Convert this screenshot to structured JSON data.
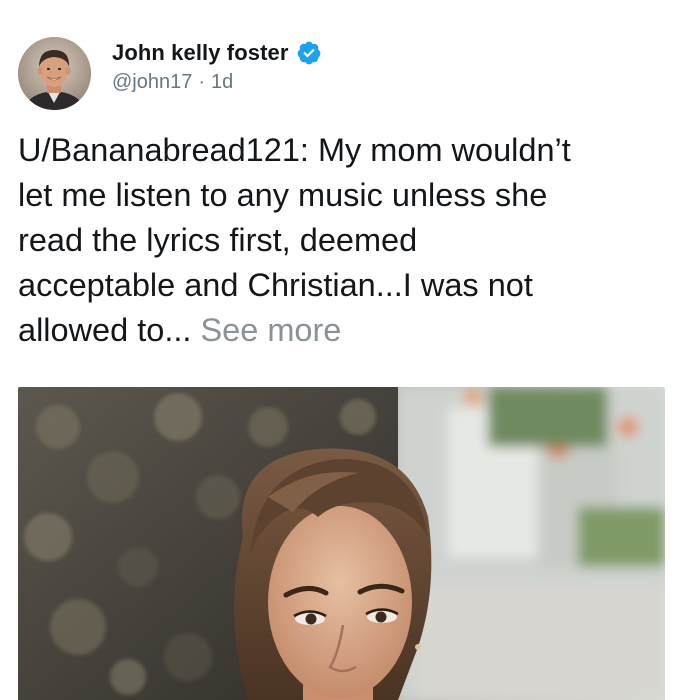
{
  "tweet": {
    "author": {
      "display_name": "John kelly foster",
      "handle": "@john17",
      "verified": true,
      "avatar_icon": "profile-photo"
    },
    "separator": "·",
    "age": "1d",
    "text": "U/Bananabread121: My mom wouldn’t\nlet me listen to any music unless she\nread the lyrics first, deemed\nacceptable and Christian...I was not\nallowed to...",
    "see_more_label": "See more",
    "media": {
      "type": "photo",
      "icon": "photo-of-woman-with-short-brown-hair"
    }
  },
  "colors": {
    "text_primary": "#14171a",
    "text_secondary": "#657786",
    "verified_blue": "#1da1f2",
    "see_more_gray": "#8a9299"
  }
}
